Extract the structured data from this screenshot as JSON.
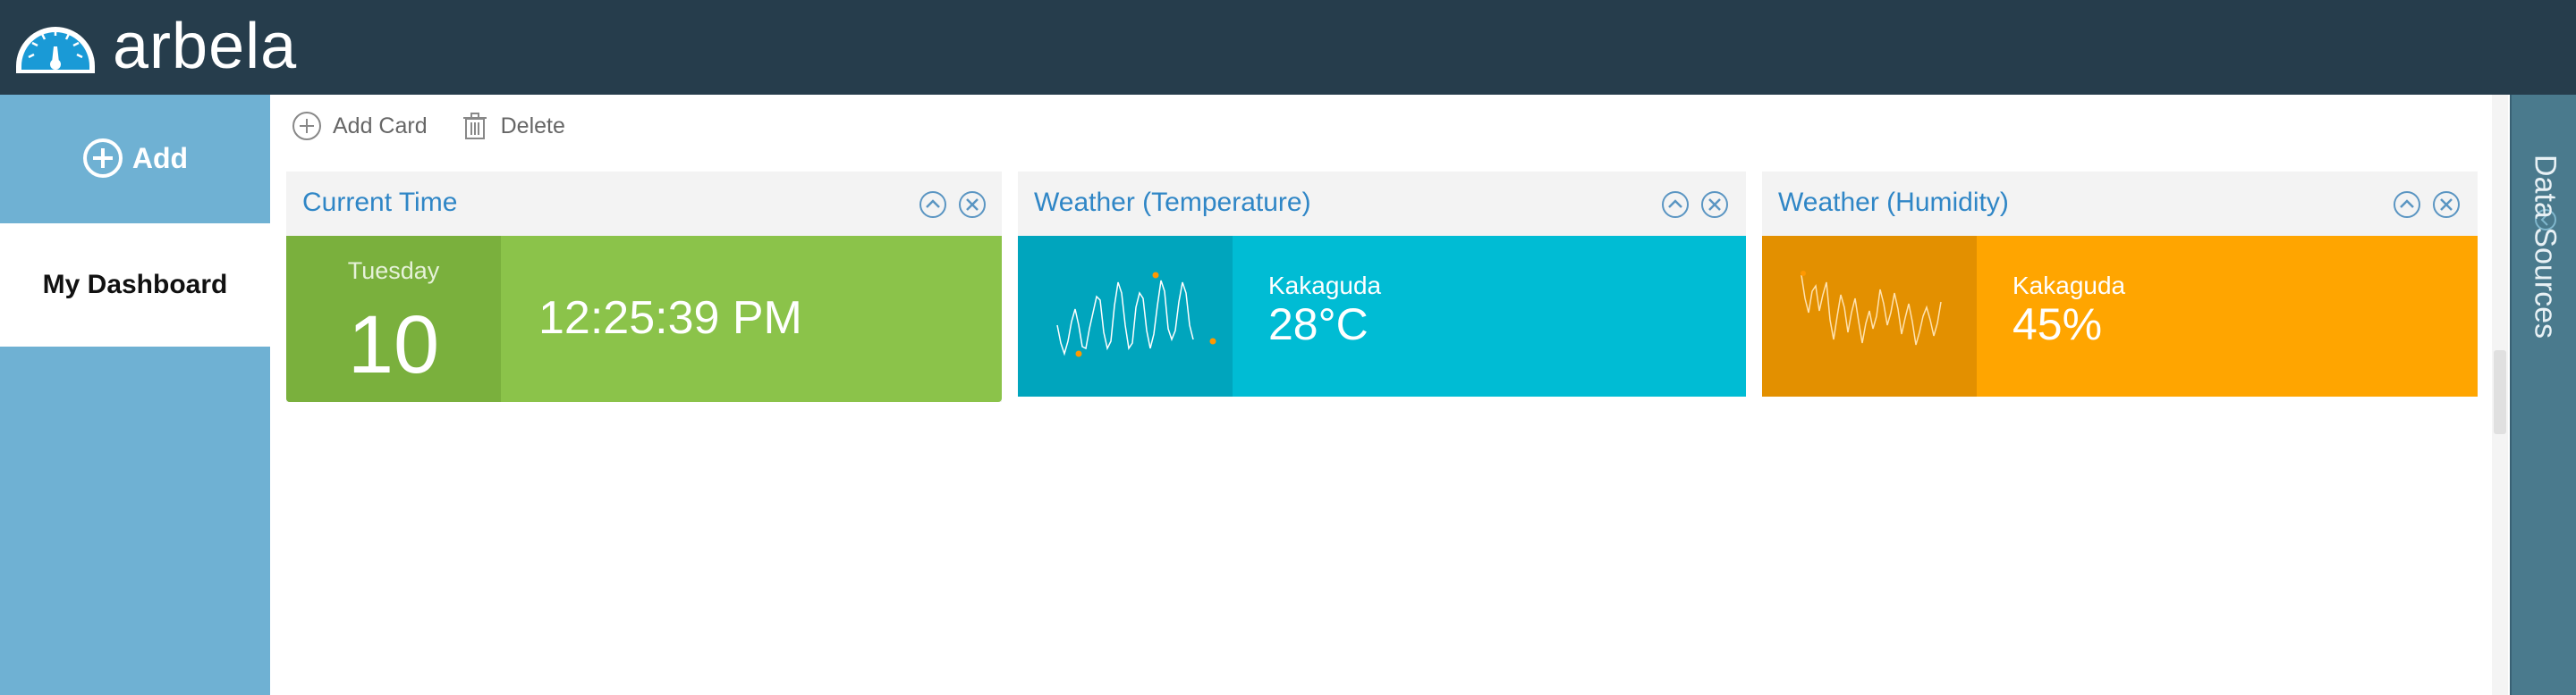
{
  "app": {
    "title": "arbela"
  },
  "sidebar": {
    "add_label": "Add",
    "dashboard_label": "My Dashboard"
  },
  "toolbar": {
    "add_card_label": "Add Card",
    "delete_label": "Delete"
  },
  "cards": [
    {
      "title": "Current Time",
      "day_name": "Tuesday",
      "day_number": "10",
      "time": "12:25:39 PM",
      "colors": {
        "left": "#7ab03d",
        "right": "#8bc34a"
      }
    },
    {
      "title": "Weather (Temperature)",
      "location": "Kakaguda",
      "value": "28°C",
      "colors": {
        "left": "#00a5bd",
        "right": "#00bcd4"
      }
    },
    {
      "title": "Weather (Humidity)",
      "location": "Kakaguda",
      "value": "45%",
      "colors": {
        "left": "#e39000",
        "right": "#ffa500"
      }
    }
  ],
  "data_sources": {
    "label": "Data Sources"
  },
  "icons": {
    "logo": "gauge-icon",
    "add": "plus-circle-icon",
    "add_card": "plus-circle-icon",
    "delete": "trash-icon",
    "collapse": "chevron-up-circle-icon",
    "close": "close-circle-icon",
    "data_sources_toggle": "chevron-circle-icon"
  },
  "colors": {
    "header": "#263d4c",
    "sidebar": "#6fb1d3",
    "accent_text": "#2f86c6",
    "data_sources_panel": "#4a7a8d"
  }
}
